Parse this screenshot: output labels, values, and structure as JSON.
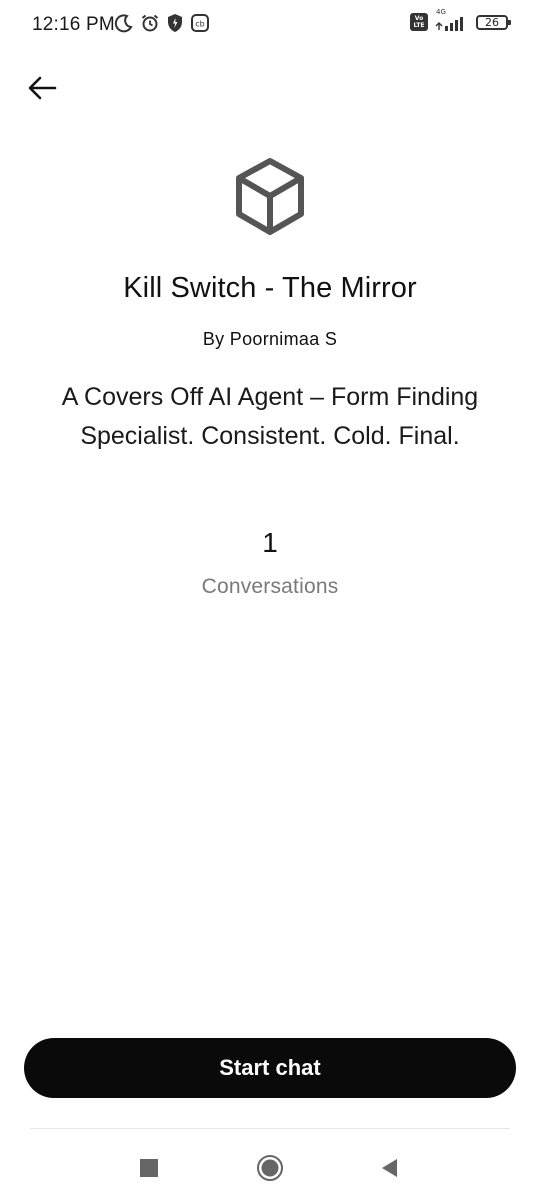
{
  "status_bar": {
    "time": "12:16 PM",
    "battery": "26",
    "network": "4G",
    "volte": "Vo LTE",
    "icons": [
      "moon-icon",
      "alarm-icon",
      "shield-icon",
      "app-notification-icon",
      "signal-icon",
      "battery-icon"
    ]
  },
  "header": {
    "back_icon": "arrow-left-icon"
  },
  "agent": {
    "icon": "cube-icon",
    "title": "Kill Switch - The Mirror",
    "author": "By Poornimaa S",
    "description": "A Covers Off AI Agent – Form Finding Specialist. Consistent. Cold. Final.",
    "stats": {
      "count": "1",
      "label": "Conversations"
    }
  },
  "actions": {
    "start_chat_label": "Start chat"
  },
  "nav_bar": {
    "icons": [
      "recents-square-icon",
      "home-circle-icon",
      "back-triangle-icon"
    ]
  },
  "colors": {
    "button_bg": "#0a0a0a",
    "button_text": "#ffffff",
    "muted_text": "#7a7a7a",
    "icon_gray": "#555555"
  }
}
